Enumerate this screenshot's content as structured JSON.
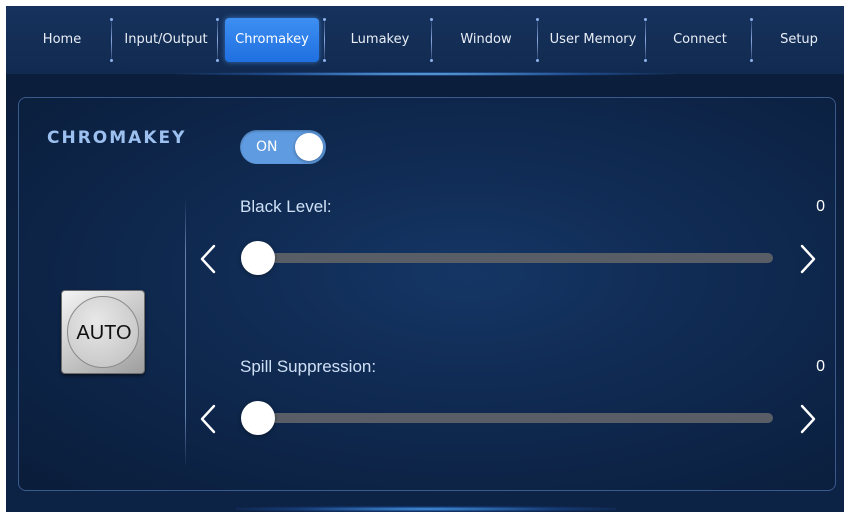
{
  "nav": {
    "tabs": [
      {
        "label": "Home",
        "active": false
      },
      {
        "label": "Input/Output",
        "active": false
      },
      {
        "label": "Chromakey",
        "active": true
      },
      {
        "label": "Lumakey",
        "active": false
      },
      {
        "label": "Window",
        "active": false
      },
      {
        "label": "User Memory",
        "active": false
      },
      {
        "label": "Connect",
        "active": false
      },
      {
        "label": "Setup",
        "active": false
      }
    ]
  },
  "panel": {
    "title": "CHROMAKEY",
    "toggle": {
      "label": "ON",
      "state": "on"
    },
    "auto_button": {
      "label": "AUTO"
    },
    "sliders": [
      {
        "label": "Black Level:",
        "value": "0",
        "level": 0
      },
      {
        "label": "Spill Suppression:",
        "value": "0",
        "level": 0
      }
    ]
  },
  "colors": {
    "background": "#0b1d3a",
    "nav_active": "#2f82ea",
    "toggle_on": "#5f9be0",
    "track": "#595e66",
    "title": "#9cc0f0"
  },
  "icons": [
    "chevron-left-icon",
    "chevron-right-icon"
  ]
}
